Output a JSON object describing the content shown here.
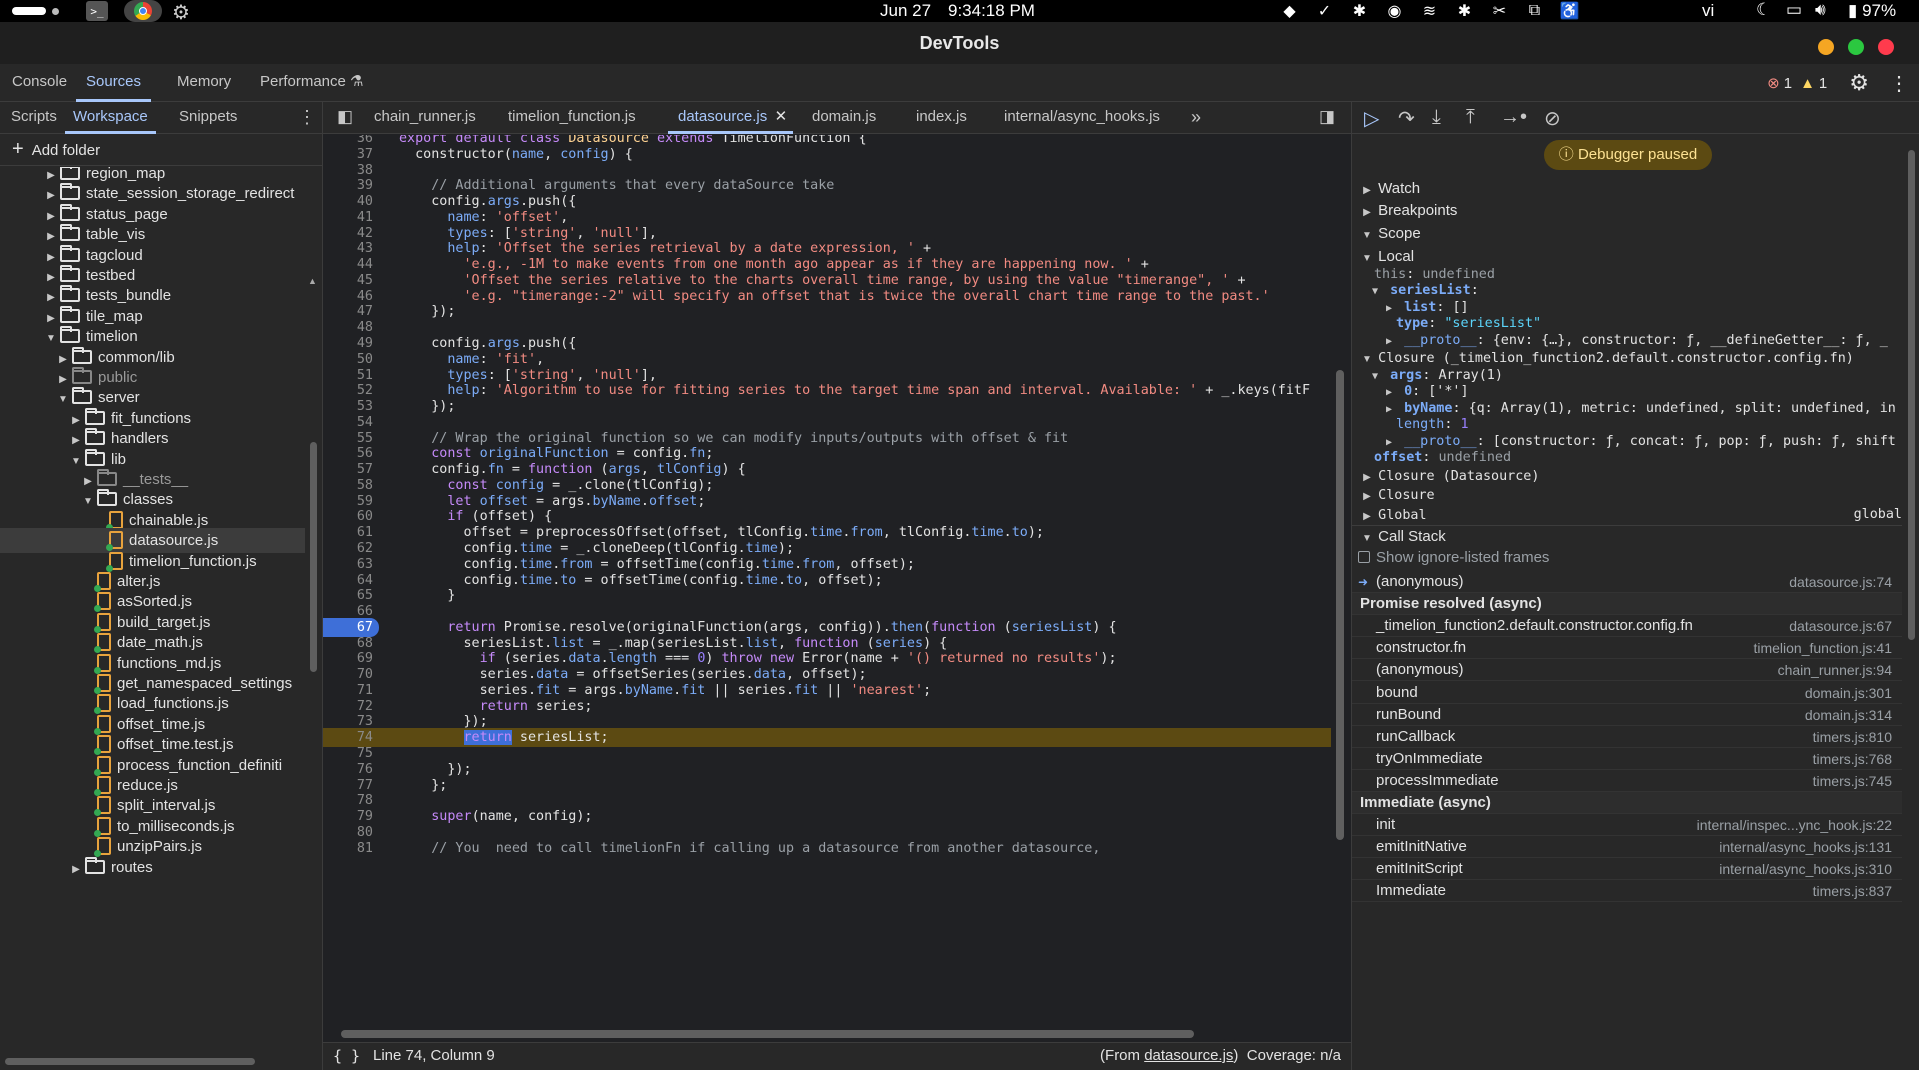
{
  "system": {
    "date": "Jun 27",
    "time": "9:34:18 PM",
    "lang": "vi",
    "battery": "97%"
  },
  "window": {
    "title": "DevTools"
  },
  "main_tabs": [
    "Console",
    "Sources",
    "Memory",
    "Performance"
  ],
  "issues": {
    "errors": "1",
    "warnings": "1"
  },
  "navigator": {
    "tabs": [
      "Scripts",
      "Workspace",
      "Snippets"
    ],
    "add_folder": "Add folder",
    "tree": [
      {
        "label": "region_map",
        "type": "folder"
      },
      {
        "label": "state_session_storage_redirect",
        "type": "folder"
      },
      {
        "label": "status_page",
        "type": "folder"
      },
      {
        "label": "table_vis",
        "type": "folder"
      },
      {
        "label": "tagcloud",
        "type": "folder"
      },
      {
        "label": "testbed",
        "type": "folder"
      },
      {
        "label": "tests_bundle",
        "type": "folder"
      },
      {
        "label": "tile_map",
        "type": "folder"
      },
      {
        "label": "timelion",
        "type": "folder-open"
      },
      {
        "label": "common/lib",
        "type": "folder"
      },
      {
        "label": "public",
        "type": "folder-dim"
      },
      {
        "label": "server",
        "type": "folder-open"
      },
      {
        "label": "fit_functions",
        "type": "folder"
      },
      {
        "label": "handlers",
        "type": "folder"
      },
      {
        "label": "lib",
        "type": "folder-open"
      },
      {
        "label": "__tests__",
        "type": "folder-dim"
      },
      {
        "label": "classes",
        "type": "folder-open"
      },
      {
        "label": "chainable.js",
        "type": "file"
      },
      {
        "label": "datasource.js",
        "type": "file"
      },
      {
        "label": "timelion_function.js",
        "type": "file"
      },
      {
        "label": "alter.js",
        "type": "file"
      },
      {
        "label": "asSorted.js",
        "type": "file"
      },
      {
        "label": "build_target.js",
        "type": "file"
      },
      {
        "label": "date_math.js",
        "type": "file"
      },
      {
        "label": "functions_md.js",
        "type": "file"
      },
      {
        "label": "get_namespaced_settings",
        "type": "file"
      },
      {
        "label": "load_functions.js",
        "type": "file"
      },
      {
        "label": "offset_time.js",
        "type": "file"
      },
      {
        "label": "offset_time.test.js",
        "type": "file"
      },
      {
        "label": "process_function_definiti",
        "type": "file"
      },
      {
        "label": "reduce.js",
        "type": "file"
      },
      {
        "label": "split_interval.js",
        "type": "file"
      },
      {
        "label": "to_milliseconds.js",
        "type": "file"
      },
      {
        "label": "unzipPairs.js",
        "type": "file"
      },
      {
        "label": "routes",
        "type": "folder"
      }
    ]
  },
  "editor": {
    "tabs": [
      "chain_runner.js",
      "timelion_function.js",
      "datasource.js",
      "domain.js",
      "index.js",
      "internal/async_hooks.js"
    ],
    "lines": [
      {
        "n": "36",
        "html": "<span class='kw'>export default class</span> <span class='ty'>Datasource</span> <span class='kw'>extends</span> TimelionFunction {"
      },
      {
        "n": "37",
        "html": "  <span class='fn'>constructor</span>(<span class='pr'>name</span>, <span class='pr'>config</span>) {"
      },
      {
        "n": "38",
        "html": ""
      },
      {
        "n": "39",
        "html": "    <span class='cm'>// Additional arguments that every dataSource take</span>"
      },
      {
        "n": "40",
        "html": "    config.<span class='pr'>args</span>.push({"
      },
      {
        "n": "41",
        "html": "      <span class='pr'>name</span>: <span class='st'>'offset'</span>,"
      },
      {
        "n": "42",
        "html": "      <span class='pr'>types</span>: [<span class='st'>'string'</span>, <span class='st'>'null'</span>],"
      },
      {
        "n": "43",
        "html": "      <span class='pr'>help</span>: <span class='st'>'Offset the series retrieval by a date expression, '</span> +"
      },
      {
        "n": "44",
        "html": "        <span class='st'>'e.g., -1M to make events from one month ago appear as if they are happening now. '</span> +"
      },
      {
        "n": "45",
        "html": "        <span class='st'>'Offset the series relative to the charts overall time range, by using the value \"timerange\", '</span> +"
      },
      {
        "n": "46",
        "html": "        <span class='st'>'e.g. \"timerange:-2\" will specify an offset that is twice the overall chart time range to the past.'</span>"
      },
      {
        "n": "47",
        "html": "    });"
      },
      {
        "n": "48",
        "html": ""
      },
      {
        "n": "49",
        "html": "    config.<span class='pr'>args</span>.push({"
      },
      {
        "n": "50",
        "html": "      <span class='pr'>name</span>: <span class='st'>'fit'</span>,"
      },
      {
        "n": "51",
        "html": "      <span class='pr'>types</span>: [<span class='st'>'string'</span>, <span class='st'>'null'</span>],"
      },
      {
        "n": "52",
        "html": "      <span class='pr'>help</span>: <span class='st'>'Algorithm to use for fitting series to the target time span and interval. Available: '</span> + _.keys(fitF"
      },
      {
        "n": "53",
        "html": "    });"
      },
      {
        "n": "54",
        "html": ""
      },
      {
        "n": "55",
        "html": "    <span class='cm'>// Wrap the original function so we can modify inputs/outputs with offset &amp; fit</span>"
      },
      {
        "n": "56",
        "html": "    <span class='kw'>const</span> <span class='pr'>originalFunction</span> = config.<span class='pr'>fn</span>;"
      },
      {
        "n": "57",
        "html": "    config.<span class='pr'>fn</span> = <span class='kw'>function</span> (<span class='pr'>args</span>, <span class='pr'>tlConfig</span>) {"
      },
      {
        "n": "58",
        "html": "      <span class='kw'>const</span> <span class='pr'>config</span> = _.clone(tlConfig);"
      },
      {
        "n": "59",
        "html": "      <span class='kw'>let</span> <span class='pr'>offset</span> = args.<span class='pr'>byName</span>.<span class='pr'>offset</span>;"
      },
      {
        "n": "60",
        "html": "      <span class='kw'>if</span> (offset) {"
      },
      {
        "n": "61",
        "html": "        offset = preprocessOffset(offset, tlConfig.<span class='pr'>time</span>.<span class='pr'>from</span>, tlConfig.<span class='pr'>time</span>.<span class='pr'>to</span>);"
      },
      {
        "n": "62",
        "html": "        config.<span class='pr'>time</span> = _.cloneDeep(tlConfig.<span class='pr'>time</span>);"
      },
      {
        "n": "63",
        "html": "        config.<span class='pr'>time</span>.<span class='pr'>from</span> = offsetTime(config.<span class='pr'>time</span>.<span class='pr'>from</span>, offset);"
      },
      {
        "n": "64",
        "html": "        config.<span class='pr'>time</span>.<span class='pr'>to</span> = offsetTime(config.<span class='pr'>time</span>.<span class='pr'>to</span>, offset);"
      },
      {
        "n": "65",
        "html": "      }"
      },
      {
        "n": "66",
        "html": ""
      },
      {
        "n": "67",
        "html": "      <span class='kw'>return</span> Promise.resolve(originalFunction(args, config)).<span class='pr'>then</span>(<span class='kw'>function</span> (<span class='pr'>seriesList</span>) {"
      },
      {
        "n": "68",
        "html": "        seriesList.<span class='pr'>list</span> = _.map(seriesList.<span class='pr'>list</span>, <span class='kw'>function</span> (<span class='pr'>series</span>) {"
      },
      {
        "n": "69",
        "html": "          <span class='kw'>if</span> (series.<span class='pr'>data</span>.<span class='pr'>length</span> === <span class='nu'>0</span>) <span class='kw'>throw new</span> Error(name + <span class='st'>'() returned no results'</span>);"
      },
      {
        "n": "70",
        "html": "          series.<span class='pr'>data</span> = offsetSeries(series.<span class='pr'>data</span>, offset);"
      },
      {
        "n": "71",
        "html": "          series.<span class='pr'>fit</span> = args.<span class='pr'>byName</span>.<span class='pr'>fit</span> || series.<span class='pr'>fit</span> || <span class='st'>'nearest'</span>;"
      },
      {
        "n": "72",
        "html": "          <span class='kw'>return</span> series;"
      },
      {
        "n": "73",
        "html": "        });"
      },
      {
        "n": "74",
        "html": "        <span style='background:#3e6fd8;color:#c58af9'>return</span> seriesList;"
      },
      {
        "n": "75",
        "html": ""
      },
      {
        "n": "76",
        "html": "      });"
      },
      {
        "n": "77",
        "html": "    };"
      },
      {
        "n": "78",
        "html": ""
      },
      {
        "n": "79",
        "html": "    <span class='kw'>super</span>(name, config);"
      },
      {
        "n": "80",
        "html": ""
      },
      {
        "n": "81",
        "html": "    <span class='cm'>// You  need to call timelionFn if calling up a datasource from another datasource,</span>"
      }
    ],
    "status": {
      "position": "Line 74, Column 9",
      "from_prefix": "(From ",
      "from_file": "datasource.js",
      "from_suffix": ")",
      "coverage": "Coverage: n/a"
    }
  },
  "debugger": {
    "paused": "Debugger paused",
    "sections": {
      "watch": "Watch",
      "breakpoints": "Breakpoints",
      "scope": "Scope",
      "callstack": "Call Stack"
    },
    "scope": {
      "local": "Local",
      "this_key": "this",
      "this_val": "undefined",
      "serieslist_key": "seriesList",
      "list_key": "list",
      "list_val": "[]",
      "type_key": "type",
      "type_val": "\"seriesList\"",
      "proto1_key": "__proto__",
      "proto1_val": "{env: {…}, constructor: ƒ, __defineGetter__: ƒ, _",
      "closure1": "Closure (_timelion_function2.default.constructor.config.fn)",
      "args_key": "args",
      "args_val": "Array(1)",
      "zero_key": "0",
      "zero_val": "['*']",
      "byname_key": "byName",
      "byname_val": "{q: Array(1), metric: undefined, split: undefined, in",
      "length_key": "length",
      "length_val": "1",
      "proto2_key": "__proto__",
      "proto2_val": "[constructor: ƒ, concat: ƒ, pop: ƒ, push: ƒ, shift",
      "offset_key": "offset",
      "offset_val": "undefined",
      "closure2": "Closure (Datasource)",
      "closure3": "Closure",
      "global": "Global",
      "global_val": "global"
    },
    "show_ignored": "Show ignore-listed frames",
    "callstack": [
      {
        "name": "(anonymous)",
        "loc": "datasource.js:74",
        "current": true
      },
      {
        "name": "Promise resolved (async)",
        "loc": "",
        "header": true
      },
      {
        "name": "_timelion_function2.default.constructor.config.fn",
        "loc": "datasource.js:67"
      },
      {
        "name": "constructor.fn",
        "loc": "timelion_function.js:41"
      },
      {
        "name": "(anonymous)",
        "loc": "chain_runner.js:94"
      },
      {
        "name": "bound",
        "loc": "domain.js:301"
      },
      {
        "name": "runBound",
        "loc": "domain.js:314"
      },
      {
        "name": "runCallback",
        "loc": "timers.js:810"
      },
      {
        "name": "tryOnImmediate",
        "loc": "timers.js:768"
      },
      {
        "name": "processImmediate",
        "loc": "timers.js:745"
      },
      {
        "name": "Immediate (async)",
        "loc": "",
        "header": true
      },
      {
        "name": "init",
        "loc": "internal/inspec...ync_hook.js:22"
      },
      {
        "name": "emitInitNative",
        "loc": "internal/async_hooks.js:131"
      },
      {
        "name": "emitInitScript",
        "loc": "internal/async_hooks.js:310"
      },
      {
        "name": "Immediate",
        "loc": "timers.js:837"
      }
    ]
  },
  "colors": {
    "accent": "#a8c7fa",
    "paused_bg": "#5c4a12",
    "paused_fg": "#fde293",
    "error": "#f28b82",
    "warning": "#fdd663"
  }
}
